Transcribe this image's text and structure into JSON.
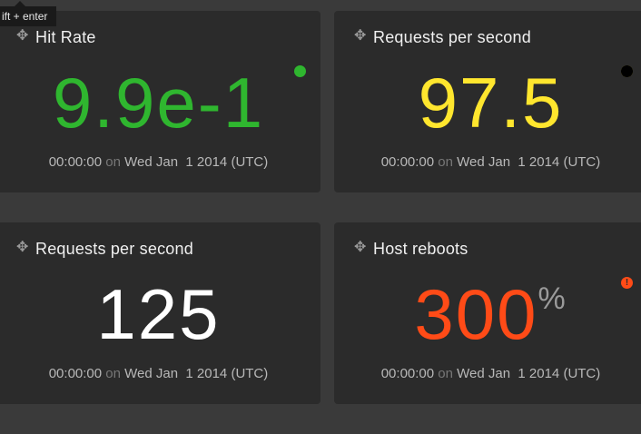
{
  "tooltip": {
    "text": "ift + enter"
  },
  "tiles": [
    {
      "title": "Hit Rate",
      "value": "9.9e-1",
      "unit": "",
      "color": "#2fb62f",
      "status": "ok",
      "time": "00:00:00",
      "on": "on",
      "date": "Wed Jan  1 2014 (UTC)"
    },
    {
      "title": "Requests per second",
      "value": "97.5",
      "unit": "",
      "color": "#ffe62e",
      "status": "warning",
      "time": "00:00:00",
      "on": "on",
      "date": "Wed Jan  1 2014 (UTC)"
    },
    {
      "title": "Requests per second",
      "value": "125",
      "unit": "",
      "color": "#ffffff",
      "status": "none",
      "time": "00:00:00",
      "on": "on",
      "date": "Wed Jan  1 2014 (UTC)"
    },
    {
      "title": "Host reboots",
      "value": "300",
      "unit": "%",
      "color": "#ff4b17",
      "status": "critical",
      "status_glyph": "!",
      "time": "00:00:00",
      "on": "on",
      "date": "Wed Jan  1 2014 (UTC)"
    }
  ]
}
